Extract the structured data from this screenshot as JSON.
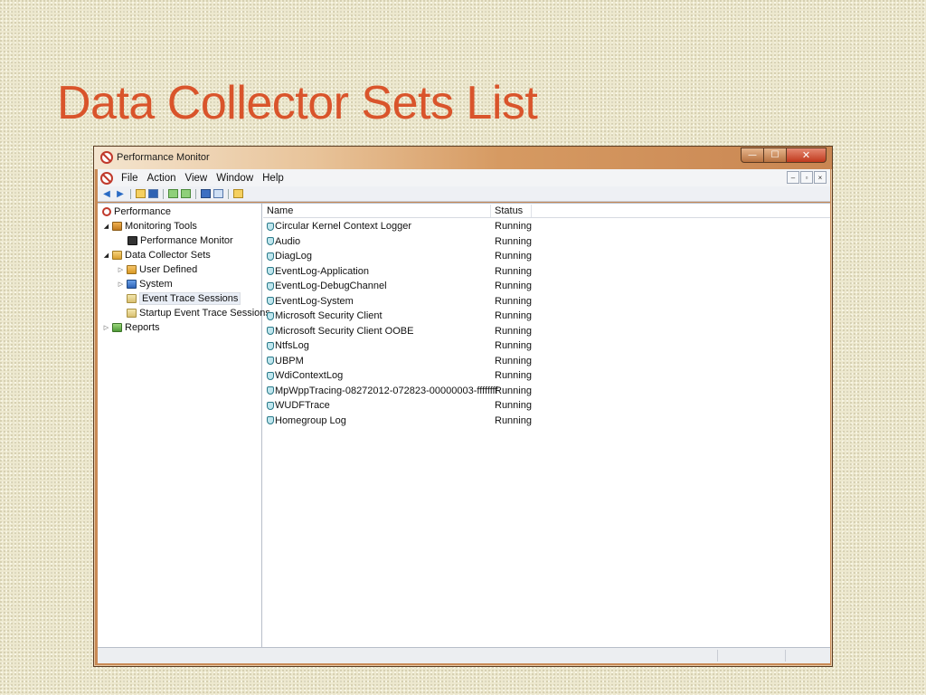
{
  "slide": {
    "title": "Data Collector Sets List"
  },
  "window": {
    "title": "Performance Monitor",
    "controls": {
      "minimize": "—",
      "maximize": "☐",
      "close": "✕"
    }
  },
  "menubar": {
    "items": [
      "File",
      "Action",
      "View",
      "Window",
      "Help"
    ],
    "mdi_controls": [
      "–",
      "▫",
      "×"
    ]
  },
  "tree": {
    "nodes": [
      {
        "label": "Performance",
        "icon": "performance-icon",
        "level": 0,
        "expander": "",
        "selected": false
      },
      {
        "label": "Monitoring Tools",
        "icon": "monitoring-tools-icon",
        "level": 1,
        "expander": "◢",
        "selected": false
      },
      {
        "label": "Performance Monitor",
        "icon": "performance-monitor-icon",
        "level": 2,
        "expander": "",
        "selected": false
      },
      {
        "label": "Data Collector Sets",
        "icon": "data-collector-sets-icon",
        "level": 1,
        "expander": "◢",
        "selected": false
      },
      {
        "label": "User Defined",
        "icon": "user-defined-icon",
        "level": 2,
        "expander": "▷",
        "selected": false
      },
      {
        "label": "System",
        "icon": "system-icon",
        "level": 2,
        "expander": "▷",
        "selected": false
      },
      {
        "label": "Event Trace Sessions",
        "icon": "event-trace-sessions-icon",
        "level": 2,
        "expander": "",
        "selected": true
      },
      {
        "label": "Startup Event Trace Sessions",
        "icon": "startup-event-trace-sessions-icon",
        "level": 2,
        "expander": "",
        "selected": false
      },
      {
        "label": "Reports",
        "icon": "reports-icon",
        "level": 1,
        "expander": "▷",
        "selected": false
      }
    ]
  },
  "list": {
    "columns": {
      "name": "Name",
      "status": "Status"
    },
    "rows": [
      {
        "name": "Circular Kernel Context Logger",
        "status": "Running"
      },
      {
        "name": "Audio",
        "status": "Running"
      },
      {
        "name": "DiagLog",
        "status": "Running"
      },
      {
        "name": "EventLog-Application",
        "status": "Running"
      },
      {
        "name": "EventLog-DebugChannel",
        "status": "Running"
      },
      {
        "name": "EventLog-System",
        "status": "Running"
      },
      {
        "name": "Microsoft Security Client",
        "status": "Running"
      },
      {
        "name": "Microsoft Security Client OOBE",
        "status": "Running"
      },
      {
        "name": "NtfsLog",
        "status": "Running"
      },
      {
        "name": "UBPM",
        "status": "Running"
      },
      {
        "name": "WdiContextLog",
        "status": "Running"
      },
      {
        "name": "MpWppTracing-08272012-072823-00000003-ffffffff",
        "status": "Running"
      },
      {
        "name": "WUDFTrace",
        "status": "Running"
      },
      {
        "name": "Homegroup Log",
        "status": "Running"
      }
    ]
  },
  "colors": {
    "title_red": "#d9542b",
    "window_frame": "#c98a55",
    "slide_background": "#ede8cf"
  }
}
